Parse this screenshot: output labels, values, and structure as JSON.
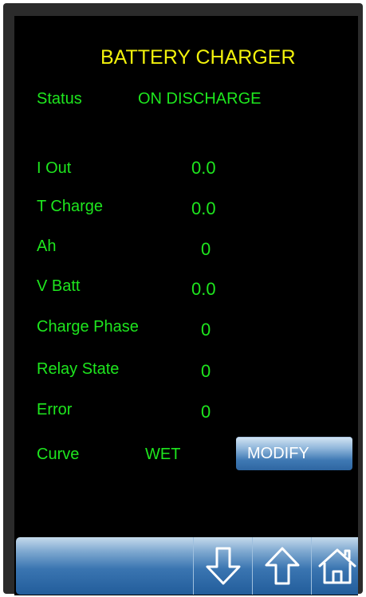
{
  "header": {
    "title": "BATTERY CHARGER"
  },
  "status": {
    "label": "Status",
    "value": "ON DISCHARGE"
  },
  "readings": [
    {
      "label": "I Out",
      "value": "0.0"
    },
    {
      "label": "T Charge",
      "value": "0.0"
    },
    {
      "label": "Ah",
      "value": "0"
    },
    {
      "label": "V Batt",
      "value": "0.0"
    },
    {
      "label": "Charge Phase",
      "value": "0"
    },
    {
      "label": "Relay State",
      "value": "0"
    },
    {
      "label": "Error",
      "value": "0"
    }
  ],
  "curve": {
    "label": "Curve",
    "value": "WET",
    "modify_label": "MODIFY"
  },
  "nav": {
    "icons": [
      "arrow-down-icon",
      "arrow-up-icon",
      "home-icon"
    ]
  },
  "colors": {
    "title": "#f2f20c",
    "text": "#1ee61e",
    "background": "#000000",
    "button": "#3f79b4"
  }
}
